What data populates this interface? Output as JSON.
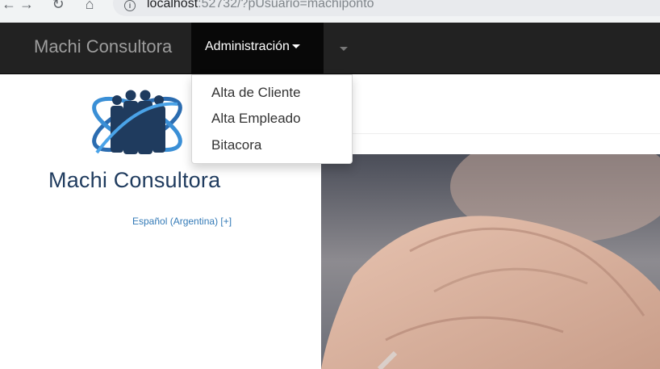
{
  "browser": {
    "url_host": "localhost",
    "url_rest": ":52732/?pUsuario=machiponto"
  },
  "navbar": {
    "brand": "Machi Consultora",
    "admin_menu_label": "Administración",
    "dropdown_items": [
      "Alta de Cliente",
      "Alta Empleado",
      "Bitacora"
    ]
  },
  "sidebar": {
    "logo_text": "Machi Consultora",
    "language_link": "Español (Argentina) [+]"
  },
  "colors": {
    "navbar_bg": "#222222",
    "logo_blue": "#2b6cb0",
    "link": "#337ab7"
  }
}
